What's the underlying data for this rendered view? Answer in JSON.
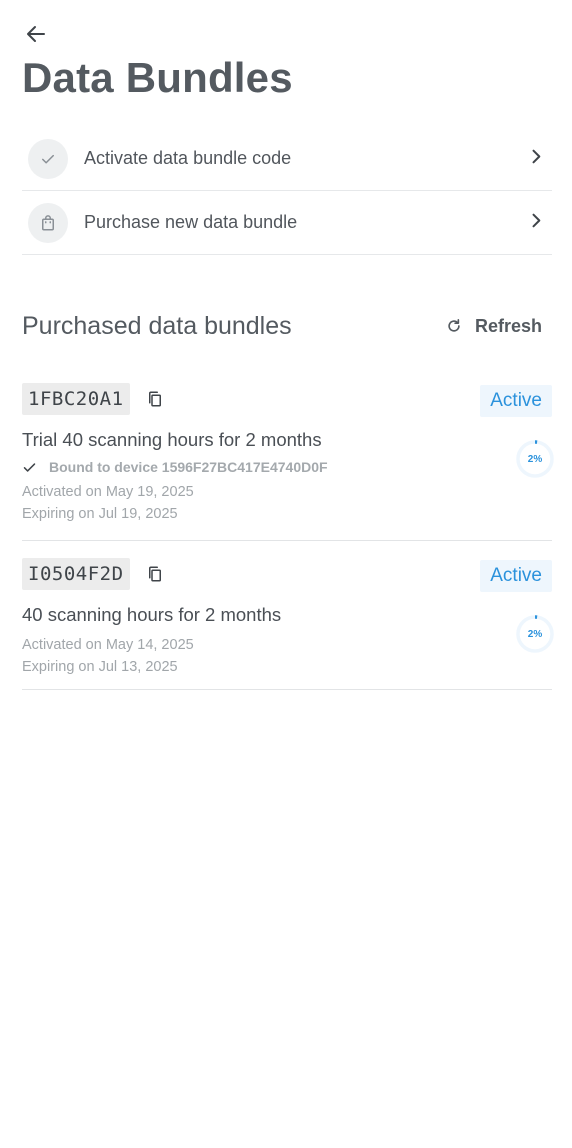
{
  "header": {
    "title": "Data Bundles"
  },
  "menu": [
    {
      "label": "Activate data bundle code",
      "icon": "check-icon"
    },
    {
      "label": "Purchase new data bundle",
      "icon": "shopping-bag-icon"
    }
  ],
  "purchased": {
    "title": "Purchased data bundles",
    "refresh_label": "Refresh",
    "bundles": [
      {
        "code": "1FBC20A1",
        "status": "Active",
        "name": "Trial 40 scanning hours for 2 months",
        "bound": "Bound to device 1596F27BC417E4740D0F",
        "activated": "Activated on May 19, 2025",
        "expiring": "Expiring on Jul 19, 2025",
        "usage_label": "2%",
        "usage_fraction": 0.02
      },
      {
        "code": "I0504F2D",
        "status": "Active",
        "name": "40 scanning hours for 2 months",
        "activated": "Activated on May 14, 2025",
        "expiring": "Expiring on Jul 13, 2025",
        "usage_label": "2%",
        "usage_fraction": 0.02
      }
    ]
  },
  "colors": {
    "accent": "#2b92dc",
    "badge_bg": "#eef6fd",
    "text": "#545a60",
    "muted": "#a1a6aa"
  }
}
